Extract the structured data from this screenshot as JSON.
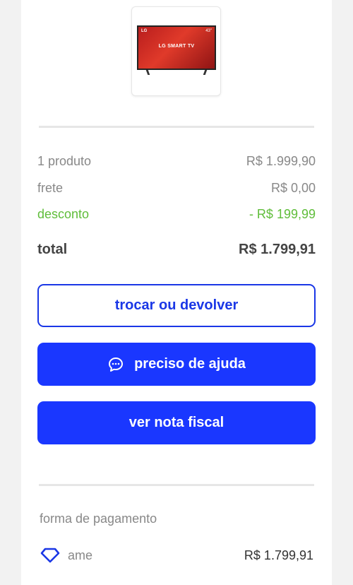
{
  "product": {
    "tv_brand": "LG",
    "tv_size": "43\"",
    "tv_title": "LG SMART TV"
  },
  "summary": {
    "items_label": "1 produto",
    "items_value": "R$ 1.999,90",
    "shipping_label": "frete",
    "shipping_value": "R$ 0,00",
    "discount_label": "desconto",
    "discount_value": "- R$ 199,99",
    "total_label": "total",
    "total_value": "R$ 1.799,91"
  },
  "actions": {
    "return_label": "trocar ou devolver",
    "help_label": "preciso de ajuda",
    "invoice_label": "ver nota fiscal"
  },
  "payment": {
    "section_label": "forma de pagamento",
    "method_name": "ame",
    "method_amount": "R$ 1.799,91"
  },
  "colors": {
    "primary": "#1a37ff",
    "discount": "#5fbd3a"
  },
  "icons": {
    "help": "chat-bubble-icon",
    "payment": "ame-heart-icon"
  }
}
